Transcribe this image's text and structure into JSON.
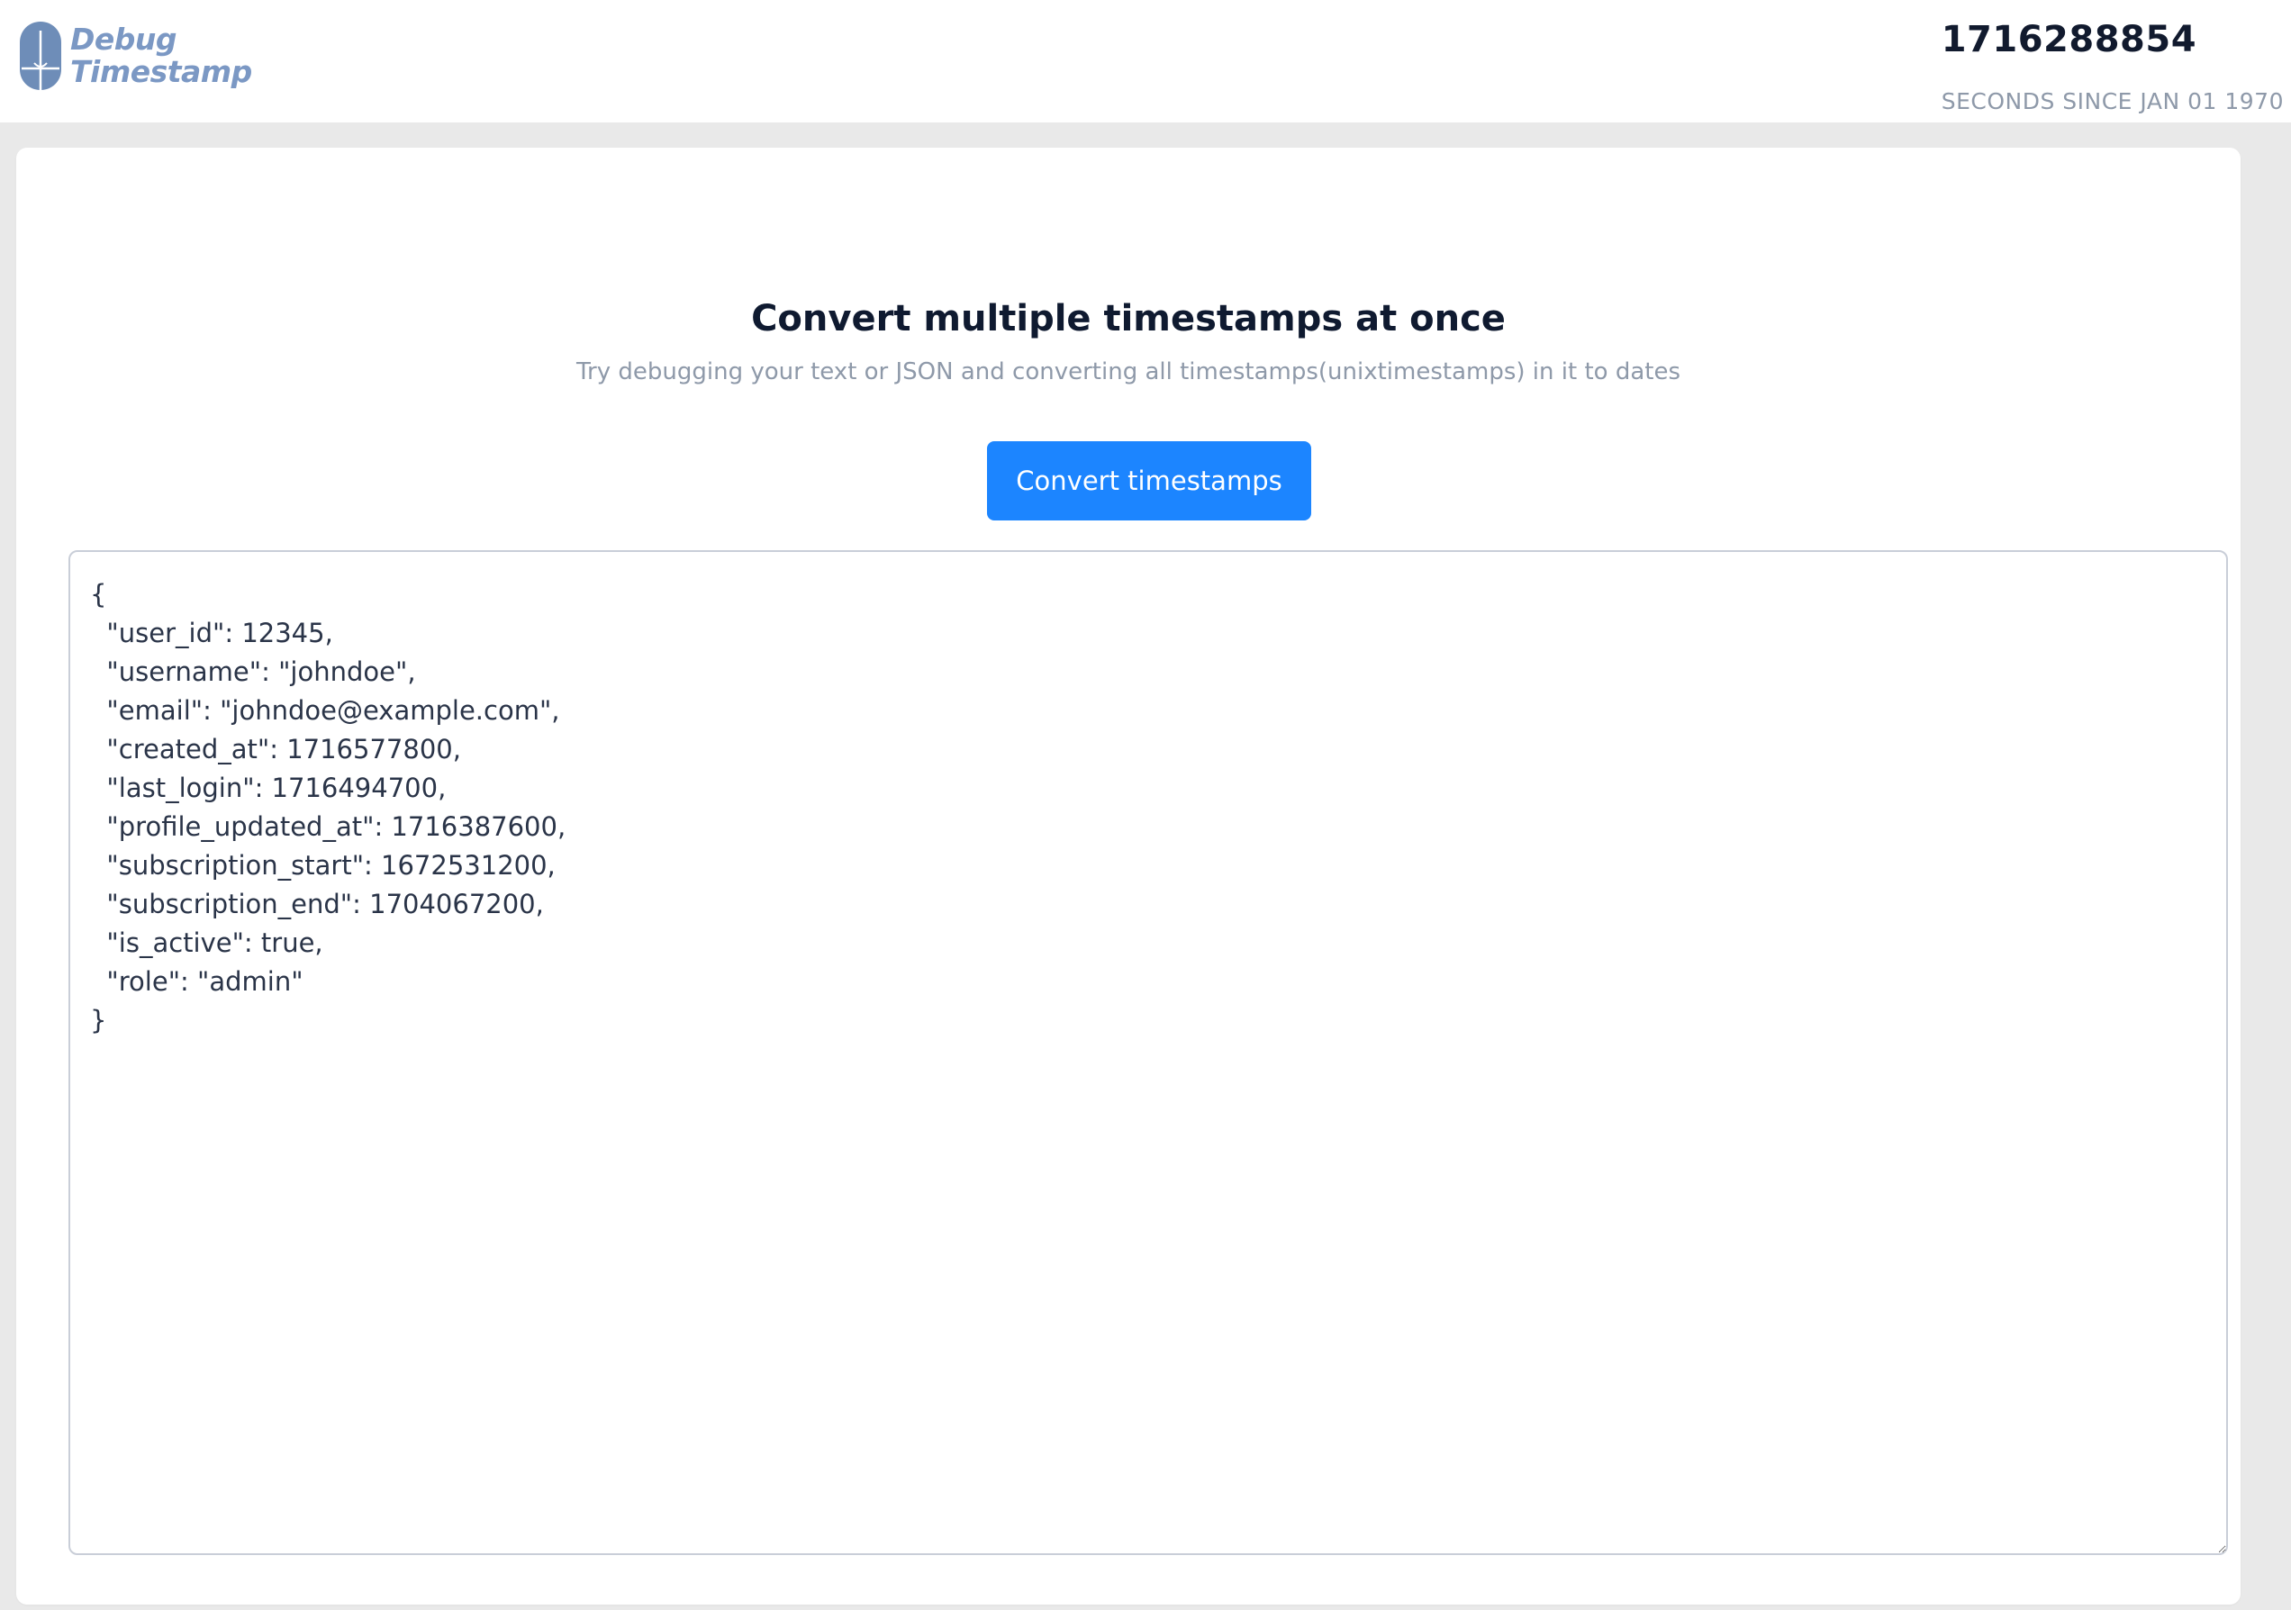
{
  "brand": {
    "line1": "Debug",
    "line2": "Timestamp",
    "logo_icon": "timestamp-logo-icon",
    "color": "#7b98c4"
  },
  "clock": {
    "value": "1716288854",
    "caption": "SECONDS SINCE JAN 01 1970"
  },
  "main": {
    "title": "Convert multiple timestamps at once",
    "subtitle": "Try debugging your text or JSON and converting all timestamps(unixtimestamps) in it to dates",
    "convert_button": "Convert timestamps",
    "accent": "#1c85ff",
    "editor_value": "{\n  \"user_id\": 12345,\n  \"username\": \"johndoe\",\n  \"email\": \"johndoe@example.com\",\n  \"created_at\": 1716577800,\n  \"last_login\": 1716494700,\n  \"profile_updated_at\": 1716387600,\n  \"subscription_start\": 1672531200,\n  \"subscription_end\": 1704067200,\n  \"is_active\": true,\n  \"role\": \"admin\"\n}"
  }
}
